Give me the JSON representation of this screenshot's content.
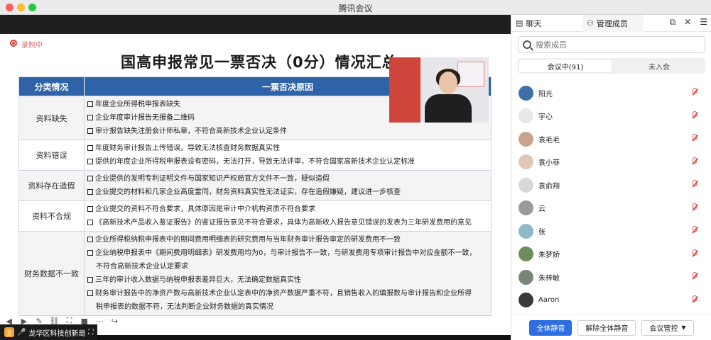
{
  "window": {
    "title": "腾讯会议"
  },
  "recording": {
    "label": "录制中"
  },
  "slide": {
    "title": "国高申报常见一票否决（0分）情况汇总",
    "headers": {
      "category": "分类情况",
      "reason": "一票否决原因"
    },
    "rows": [
      {
        "category": "资料缺失",
        "reasons": [
          "年度企业所得税申报表缺失",
          "企业年度审计报告无报备二维码",
          "审计报告缺失注册会计师私章，不符合高新技术企业认定条件"
        ]
      },
      {
        "category": "资料错误",
        "reasons": [
          "年度财务审计报告上传错误，导致无法核查财务数据真实性",
          "提供的年度企业所得税申报表设有密码，无法打开，导致无法评审，不符合国家高新技术企业认定标准"
        ]
      },
      {
        "category": "资料存在造假",
        "reasons": [
          "企业提供的发明专利证明文件与国家知识产权局官方文件不一致，疑似造假",
          "企业提交的材料和几家企业高度雷同，财务资料真实性无法证实，存在造假嫌疑，建议进一步核查"
        ]
      },
      {
        "category": "资料不合规",
        "reasons": [
          "企业提交的资料不符合要求，具体原因是审计中介机构资质不符合要求",
          "《高新技术产品收入鉴证报告》的鉴证报告意见不符合要求，具体为高新收入报告意见错误的发表为三年研发费用的意见"
        ]
      },
      {
        "category": "财务数据不一致",
        "reasons": [
          "企业所得税纳税申报表中的期间费用明细表的研究费用与当年财务审计报告审定的研发费用不一致",
          "企业纳税申报表中《期间费用明细表》研发费用均为0，与审计报告不一致，与研发费用专项审计报告中对应金额不一致，",
          "不符合高新技术企业认定要求",
          "三年的审计收入数据与纳税申报表差异巨大，无法确定数据真实性",
          "财务审计报告中的净资产数与高新技术企业认定表中的净资产数据严重不符，且销售收入的填报数与审计报告和企业所得",
          "税申报表的数据不符，无法判断企业财务数据的真实情况"
        ]
      }
    ]
  },
  "host": {
    "name": "龙华区科技创新局"
  },
  "panel": {
    "tab_chat": "聊天",
    "tab_members": "管理成员",
    "search_placeholder": "搜索成员",
    "seg_in_meeting": "会议中(91)",
    "seg_not_joined": "未入会",
    "members": [
      {
        "name": "阳光",
        "color": "#3d6fa8"
      },
      {
        "name": "宇心",
        "color": "#e8e8e8"
      },
      {
        "name": "袁毛毛",
        "color": "#c9a48a"
      },
      {
        "name": "袁小菲",
        "color": "#e0c7b8"
      },
      {
        "name": "袁俞翔",
        "color": "#d8d8d8"
      },
      {
        "name": "云",
        "color": "#9a9a9a"
      },
      {
        "name": "张",
        "color": "#8fb8c8"
      },
      {
        "name": "朱梦娇",
        "color": "#6c8c5a"
      },
      {
        "name": "朱梓敏",
        "color": "#7a8478"
      },
      {
        "name": "Aaron",
        "color": "#3a3a3a"
      }
    ],
    "btn_mute_all": "全体静音",
    "btn_unmute_all": "解除全体静音",
    "btn_control": "会议管控"
  }
}
